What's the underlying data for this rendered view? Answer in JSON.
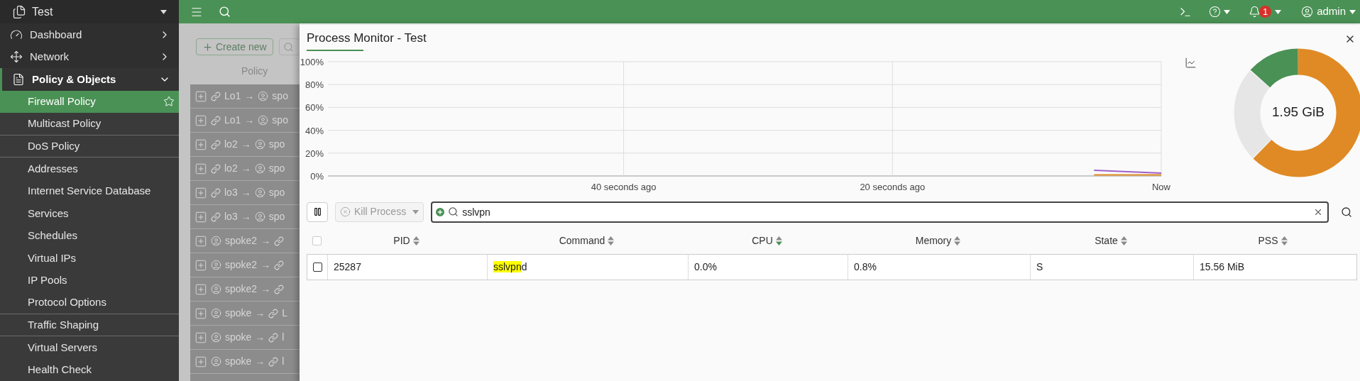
{
  "top_bar": {
    "notification_count": "1",
    "user": "admin"
  },
  "sidebar": {
    "title": "Test",
    "items": [
      {
        "label": "Dashboard",
        "kind": "dashboard",
        "expanded": false
      },
      {
        "label": "Network",
        "kind": "network",
        "expanded": false
      },
      {
        "label": "Policy & Objects",
        "kind": "policy",
        "expanded": true,
        "children": [
          {
            "label": "Firewall Policy",
            "selected": true,
            "group_end": false
          },
          {
            "label": "Multicast Policy",
            "selected": false,
            "group_end": true
          },
          {
            "label": "DoS Policy",
            "selected": false,
            "group_end": true
          },
          {
            "label": "Addresses",
            "selected": false,
            "group_end": false
          },
          {
            "label": "Internet Service Database",
            "selected": false,
            "group_end": false
          },
          {
            "label": "Services",
            "selected": false,
            "group_end": false
          },
          {
            "label": "Schedules",
            "selected": false,
            "group_end": false
          },
          {
            "label": "Virtual IPs",
            "selected": false,
            "group_end": false
          },
          {
            "label": "IP Pools",
            "selected": false,
            "group_end": false
          },
          {
            "label": "Protocol Options",
            "selected": false,
            "group_end": true
          },
          {
            "label": "Traffic Shaping",
            "selected": false,
            "group_end": true
          },
          {
            "label": "Virtual Servers",
            "selected": false,
            "group_end": false
          },
          {
            "label": "Health Check",
            "selected": false,
            "group_end": false
          }
        ]
      }
    ]
  },
  "policy_list": {
    "create_button": "Create new",
    "column": "Policy",
    "rows": [
      {
        "from": {
          "kind": "interface",
          "label": "Lo1"
        },
        "arrow": "→",
        "to": {
          "kind": "zone",
          "label": "spo"
        }
      },
      {
        "from": {
          "kind": "interface",
          "label": "Lo1"
        },
        "arrow": "→",
        "to": {
          "kind": "zone",
          "label": "spo"
        }
      },
      {
        "from": {
          "kind": "interface",
          "label": "lo2"
        },
        "arrow": "→",
        "to": {
          "kind": "zone",
          "label": "spo"
        }
      },
      {
        "from": {
          "kind": "interface",
          "label": "lo2"
        },
        "arrow": "→",
        "to": {
          "kind": "zone",
          "label": "spo"
        }
      },
      {
        "from": {
          "kind": "interface",
          "label": "lo3"
        },
        "arrow": "→",
        "to": {
          "kind": "zone",
          "label": "spo"
        }
      },
      {
        "from": {
          "kind": "interface",
          "label": "lo3"
        },
        "arrow": "→",
        "to": {
          "kind": "zone",
          "label": "spo"
        }
      },
      {
        "from": {
          "kind": "zone",
          "label": "spoke2"
        },
        "arrow": "→",
        "to": {
          "kind": "interface"
        }
      },
      {
        "from": {
          "kind": "zone",
          "label": "spoke2"
        },
        "arrow": "→",
        "to": {
          "kind": "interface"
        }
      },
      {
        "from": {
          "kind": "zone",
          "label": "spoke2"
        },
        "arrow": "→",
        "to": {
          "kind": "interface"
        }
      },
      {
        "from": {
          "kind": "zone",
          "label": "spoke"
        },
        "arrow": "→",
        "to": {
          "kind": "interface",
          "label": "L"
        }
      },
      {
        "from": {
          "kind": "zone",
          "label": "spoke"
        },
        "arrow": "→",
        "to": {
          "kind": "interface",
          "label": "l"
        }
      },
      {
        "from": {
          "kind": "zone",
          "label": "spoke"
        },
        "arrow": "→",
        "to": {
          "kind": "interface",
          "label": "l"
        }
      }
    ]
  },
  "process_monitor": {
    "title": "Process Monitor - Test",
    "chart_data": {
      "type": "line",
      "grid": true,
      "x": [
        -5,
        0
      ],
      "xlim": [
        -62,
        0
      ],
      "ylim": [
        0,
        100
      ],
      "xticks": [
        {
          "value": -40,
          "label": "40 seconds ago"
        },
        {
          "value": -20,
          "label": "20 seconds ago"
        },
        {
          "value": 0,
          "label": "Now"
        }
      ],
      "yticks": [
        {
          "value": 0,
          "label": "0%"
        },
        {
          "value": 20,
          "label": "20%"
        },
        {
          "value": 40,
          "label": "40%"
        },
        {
          "value": 60,
          "label": "60%"
        },
        {
          "value": 80,
          "label": "80%"
        },
        {
          "value": 100,
          "label": "100%"
        }
      ],
      "series": [
        {
          "color": "#a060c8",
          "values": [
            5,
            2.5
          ]
        },
        {
          "color": "#e08a25",
          "values": [
            1,
            1
          ]
        }
      ]
    },
    "memory_total": "1.95 GiB",
    "kill_button": {
      "label": "Kill Process",
      "disabled": true
    },
    "search": {
      "value": "sslvpn"
    },
    "table": {
      "select_all": {
        "checked": false,
        "disabled": true
      },
      "columns": [
        {
          "label": "PID",
          "sorted": false
        },
        {
          "label": "Command",
          "sorted": false
        },
        {
          "label": "CPU",
          "sorted": true
        },
        {
          "label": "Memory",
          "sorted": false
        },
        {
          "label": "State",
          "sorted": false
        },
        {
          "label": "PSS",
          "sorted": false
        }
      ],
      "rows": [
        {
          "checked": false,
          "pid": "25287",
          "command_match": "sslvpn",
          "command_rest": "d",
          "cpu": "0.0%",
          "memory": "0.8%",
          "state": "S",
          "pss": "15.56 MiB"
        }
      ]
    }
  }
}
